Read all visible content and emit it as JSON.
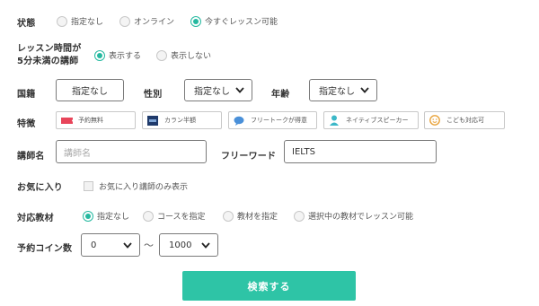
{
  "status": {
    "label": "状態",
    "options": [
      "指定なし",
      "オンライン",
      "今すぐレッスン可能"
    ],
    "selected": "今すぐレッスン可能"
  },
  "lesson_time": {
    "label_line1": "レッスン時間が",
    "label_line2": "5分未満の講師",
    "options": [
      "表示する",
      "表示しない"
    ],
    "selected": "表示する"
  },
  "nationality": {
    "label": "国籍",
    "value": "指定なし"
  },
  "gender": {
    "label": "性別",
    "value": "指定なし"
  },
  "age": {
    "label": "年齢",
    "value": "指定なし"
  },
  "features": {
    "label": "特徴",
    "chips": [
      {
        "label": "予約無料",
        "icon": "ticket-icon",
        "color": "#e8455a"
      },
      {
        "label": "カラン半額",
        "icon": "callan-logo-icon",
        "color": "#1f3a6b"
      },
      {
        "label": "フリートークが得意",
        "icon": "speech-bubble-icon",
        "color": "#4a90d9"
      },
      {
        "label": "ネイティブスピーカー",
        "icon": "person-icon",
        "color": "#3cb8c8"
      },
      {
        "label": "こども対応可",
        "icon": "smiley-icon",
        "color": "#e8a33c"
      }
    ]
  },
  "tutor_name": {
    "label": "講師名",
    "placeholder": "講師名"
  },
  "free_word": {
    "label": "フリーワード",
    "value": "IELTS"
  },
  "favorites": {
    "label": "お気に入り",
    "checkbox_label": "お気に入り講師のみ表示"
  },
  "material": {
    "label": "対応教材",
    "options": [
      "指定なし",
      "コースを指定",
      "教材を指定",
      "選択中の教材でレッスン可能"
    ],
    "selected": "指定なし"
  },
  "coins": {
    "label": "予約コイン数",
    "min": "0",
    "separator": "〜",
    "max": "1000"
  },
  "submit_label": "検索する",
  "accent_color": "#2ec4a6"
}
